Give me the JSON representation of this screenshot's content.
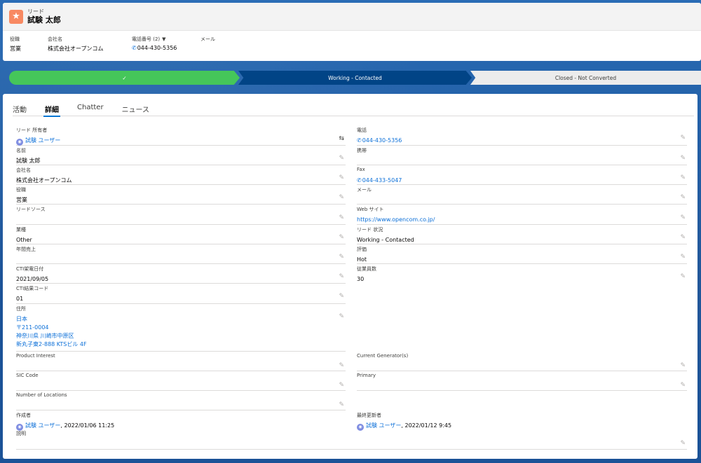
{
  "header": {
    "object_type": "リード",
    "record_name": "試験 太郎",
    "icon": "star-icon"
  },
  "highlights": [
    {
      "label": "役職",
      "value": "営業"
    },
    {
      "label": "会社名",
      "value": "株式会社オープンコム"
    },
    {
      "label": "電話番号 (2)",
      "value": "044-430-5356"
    },
    {
      "label": "メール",
      "value": ""
    }
  ],
  "path": {
    "steps": [
      {
        "label": "✓",
        "state": "complete"
      },
      {
        "label": "Working - Contacted",
        "state": "current"
      },
      {
        "label": "Closed - Not Converted",
        "state": "future"
      }
    ]
  },
  "tabs": [
    "活動",
    "詳細",
    "Chatter",
    "ニュース"
  ],
  "active_tab": "詳細",
  "fields_left": [
    {
      "label": "リード 所有者",
      "value": "試験 ユーザー"
    },
    {
      "label": "名前",
      "value": "試験 太郎"
    },
    {
      "label": "会社名",
      "value": "株式会社オープンコム"
    },
    {
      "label": "役職",
      "value": "営業"
    },
    {
      "label": "リードソース",
      "value": ""
    },
    {
      "label": "業種",
      "value": "Other"
    },
    {
      "label": "年間売上",
      "value": ""
    },
    {
      "label": "CTI架電日付",
      "value": "2021/09/05"
    },
    {
      "label": "CTI結果コード",
      "value": "01"
    },
    {
      "label": "住所",
      "address": [
        "日本",
        "〒211-0004",
        "神奈川県 川崎市中原区",
        "新丸子東2-888 KTSビル 4F"
      ]
    },
    {
      "label": "Product Interest",
      "value": ""
    },
    {
      "label": "SIC Code",
      "value": ""
    },
    {
      "label": "Number of Locations",
      "value": ""
    },
    {
      "label": "作成者",
      "user": "試験 ユーザー",
      "date": ", 2022/01/06 11:25"
    },
    {
      "label": "説明",
      "value": ""
    }
  ],
  "fields_right": [
    {
      "label": "電話",
      "value": "044-430-5356"
    },
    {
      "label": "携帯",
      "value": ""
    },
    {
      "label": "Fax",
      "value": "044-433-5047"
    },
    {
      "label": "メール",
      "value": ""
    },
    {
      "label": "Web サイト",
      "value": "https://www.opencom.co.jp/"
    },
    {
      "label": "リード 状況",
      "value": "Working - Contacted"
    },
    {
      "label": "評価",
      "value": "Hot"
    },
    {
      "label": "従業員数",
      "value": "30"
    },
    {
      "label": "Current Generator(s)",
      "value": ""
    },
    {
      "label": "Primary",
      "value": ""
    },
    {
      "label": "最終更新者",
      "user": "試験 ユーザー",
      "date": ", 2022/01/12 9:45"
    }
  ],
  "colors": {
    "brand": "#0176d3",
    "path_complete": "#45c65a",
    "path_current": "#014486",
    "lead_icon": "#f88962",
    "link": "#0b6fd8"
  }
}
